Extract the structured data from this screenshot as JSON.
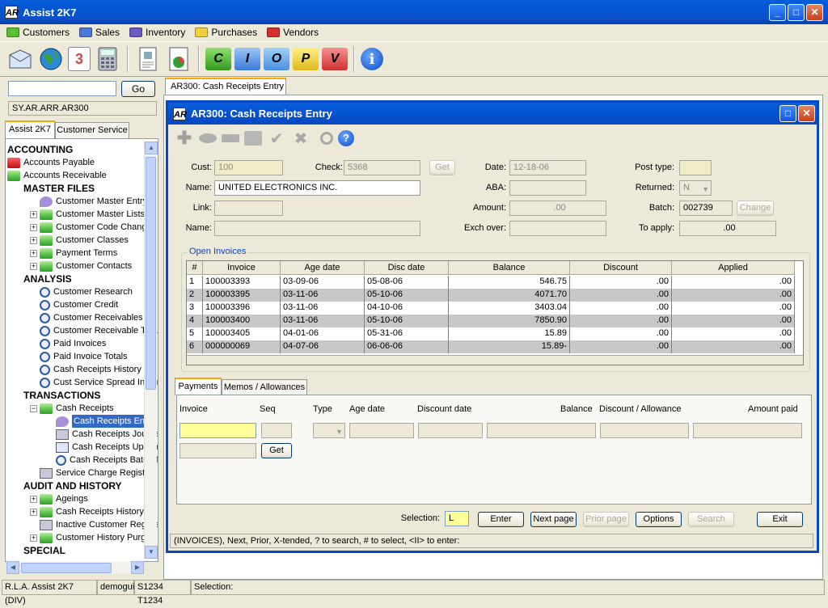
{
  "app": {
    "title": "Assist 2K7",
    "logo": "AR"
  },
  "menu": [
    {
      "label": "Customers",
      "color": "#58c030"
    },
    {
      "label": "Sales",
      "color": "#4a7ad8"
    },
    {
      "label": "Inventory",
      "color": "#6a5ac0"
    },
    {
      "label": "Purchases",
      "color": "#f0d040"
    },
    {
      "label": "Vendors",
      "color": "#d03030"
    }
  ],
  "toolbar": {
    "icons": [
      "mail-icon",
      "globe-icon",
      "calendar-icon",
      "calculator-icon",
      "report-icon",
      "chart-icon",
      "c-folder-icon",
      "i-folder-icon",
      "o-folder-icon",
      "p-folder-icon",
      "v-folder-icon",
      "info-icon"
    ],
    "calendar_text": "3",
    "folder_letters": [
      "C",
      "I",
      "O",
      "P",
      "V"
    ],
    "info_text": "i"
  },
  "left": {
    "go_label": "Go",
    "path": "SY.AR.ARR.AR300",
    "tabs": [
      "Assist 2K7",
      "Customer Service"
    ],
    "tree": [
      {
        "label": "ACCOUNTING",
        "type": "hdr",
        "indent": 0
      },
      {
        "label": "Accounts Payable",
        "type": "red",
        "indent": 0
      },
      {
        "label": "Accounts Receivable",
        "type": "green",
        "indent": 0
      },
      {
        "label": "MASTER FILES",
        "type": "hdr",
        "indent": 1
      },
      {
        "label": "Customer Master Entry",
        "type": "eye",
        "indent": 2
      },
      {
        "label": "Customer Master Lists / Lal",
        "type": "green",
        "indent": 2,
        "exp": "+"
      },
      {
        "label": "Customer Code Change / D",
        "type": "green",
        "indent": 2,
        "exp": "+"
      },
      {
        "label": "Customer Classes",
        "type": "green",
        "indent": 2,
        "exp": "+"
      },
      {
        "label": "Payment Terms",
        "type": "green",
        "indent": 2,
        "exp": "+"
      },
      {
        "label": "Customer Contacts",
        "type": "green",
        "indent": 2,
        "exp": "+"
      },
      {
        "label": "ANALYSIS",
        "type": "hdr",
        "indent": 1
      },
      {
        "label": "Customer Research",
        "type": "mag",
        "indent": 2
      },
      {
        "label": "Customer Credit",
        "type": "mag",
        "indent": 2
      },
      {
        "label": "Customer Receivables",
        "type": "mag",
        "indent": 2
      },
      {
        "label": "Customer Receivable Total",
        "type": "mag",
        "indent": 2
      },
      {
        "label": "Paid Invoices",
        "type": "mag",
        "indent": 2
      },
      {
        "label": "Paid Invoice Totals",
        "type": "mag",
        "indent": 2
      },
      {
        "label": "Cash Receipts History",
        "type": "mag",
        "indent": 2
      },
      {
        "label": "Cust Service Spread Inquir",
        "type": "mag",
        "indent": 2
      },
      {
        "label": "TRANSACTIONS",
        "type": "hdr",
        "indent": 1
      },
      {
        "label": "Cash Receipts",
        "type": "green",
        "indent": 2,
        "exp": "−"
      },
      {
        "label": "Cash Receipts Entry",
        "type": "eye",
        "indent": 3,
        "selected": true
      },
      {
        "label": "Cash Receipts Journal",
        "type": "print",
        "indent": 3
      },
      {
        "label": "Cash Receipts Update",
        "type": "doc",
        "indent": 3
      },
      {
        "label": "Cash Receipts Batch Tr",
        "type": "mag",
        "indent": 3
      },
      {
        "label": "Service Charge Register",
        "type": "print",
        "indent": 2
      },
      {
        "label": "AUDIT AND HISTORY",
        "type": "hdr",
        "indent": 1
      },
      {
        "label": "Ageings",
        "type": "green",
        "indent": 2,
        "exp": "+"
      },
      {
        "label": "Cash Receipts History",
        "type": "green",
        "indent": 2,
        "exp": "+"
      },
      {
        "label": "Inactive Customer Registe",
        "type": "print",
        "indent": 2
      },
      {
        "label": "Customer History Purges",
        "type": "green",
        "indent": 2,
        "exp": "+"
      },
      {
        "label": "SPECIAL",
        "type": "hdr",
        "indent": 1
      }
    ]
  },
  "outer_tab": "AR300: Cash Receipts Entry",
  "form": {
    "title": "AR300: Cash Receipts Entry",
    "labels": {
      "cust": "Cust:",
      "check": "Check:",
      "date": "Date:",
      "post_type": "Post type:",
      "name": "Name:",
      "aba": "ABA:",
      "returned": "Returned:",
      "link": "Link:",
      "amount": "Amount:",
      "batch": "Batch:",
      "name2": "Name:",
      "exch_over": "Exch over:",
      "to_apply": "To apply:"
    },
    "values": {
      "cust": "100",
      "check": "5368",
      "date": "12-18-06",
      "post_type": "",
      "name": "UNITED ELECTRONICS INC.",
      "aba": "",
      "returned": "N",
      "link": "",
      "amount": ".00",
      "batch": "002739",
      "name2": "",
      "exch_over": "",
      "to_apply": ".00"
    },
    "buttons": {
      "get": "Get",
      "change": "Change"
    },
    "open_invoices_label": "Open Invoices",
    "columns": [
      "#",
      "Invoice",
      "Age date",
      "Disc date",
      "Balance",
      "Discount",
      "Applied"
    ],
    "rows": [
      [
        "1",
        "100003393",
        "03-09-06",
        "05-08-06",
        "546.75",
        ".00",
        ".00"
      ],
      [
        "2",
        "100003395",
        "03-11-06",
        "05-10-06",
        "4071.70",
        ".00",
        ".00"
      ],
      [
        "3",
        "100003396",
        "03-11-06",
        "04-10-06",
        "3403.04",
        ".00",
        ".00"
      ],
      [
        "4",
        "100003400",
        "03-11-06",
        "05-10-06",
        "7850.90",
        ".00",
        ".00"
      ],
      [
        "5",
        "100003405",
        "04-01-06",
        "05-31-06",
        "15.89",
        ".00",
        ".00"
      ],
      [
        "6",
        "000000069",
        "04-07-06",
        "06-06-06",
        "15.89-",
        ".00",
        ".00"
      ]
    ],
    "detail_tabs": [
      "Payments",
      "Memos / Allowances"
    ],
    "detail_headers": [
      "Invoice",
      "Seq",
      "Type",
      "Age date",
      "Discount date",
      "Balance",
      "Discount / Allowance",
      "Amount paid"
    ],
    "detail_get": "Get",
    "selection_label": "Selection:",
    "selection_value": "L",
    "actions": [
      "Enter",
      "Next page",
      "Prior page",
      "Options",
      "Search",
      "Exit"
    ],
    "status": "(INVOICES),  Next,  Prior,  X-tended,  ? to search,  # to select,  <II> to enter:"
  },
  "statusbar": {
    "app": "R.L.A. Assist 2K7 (DIV)",
    "user": "demogui",
    "session": "S1234 T1234",
    "selection": "Selection:"
  }
}
